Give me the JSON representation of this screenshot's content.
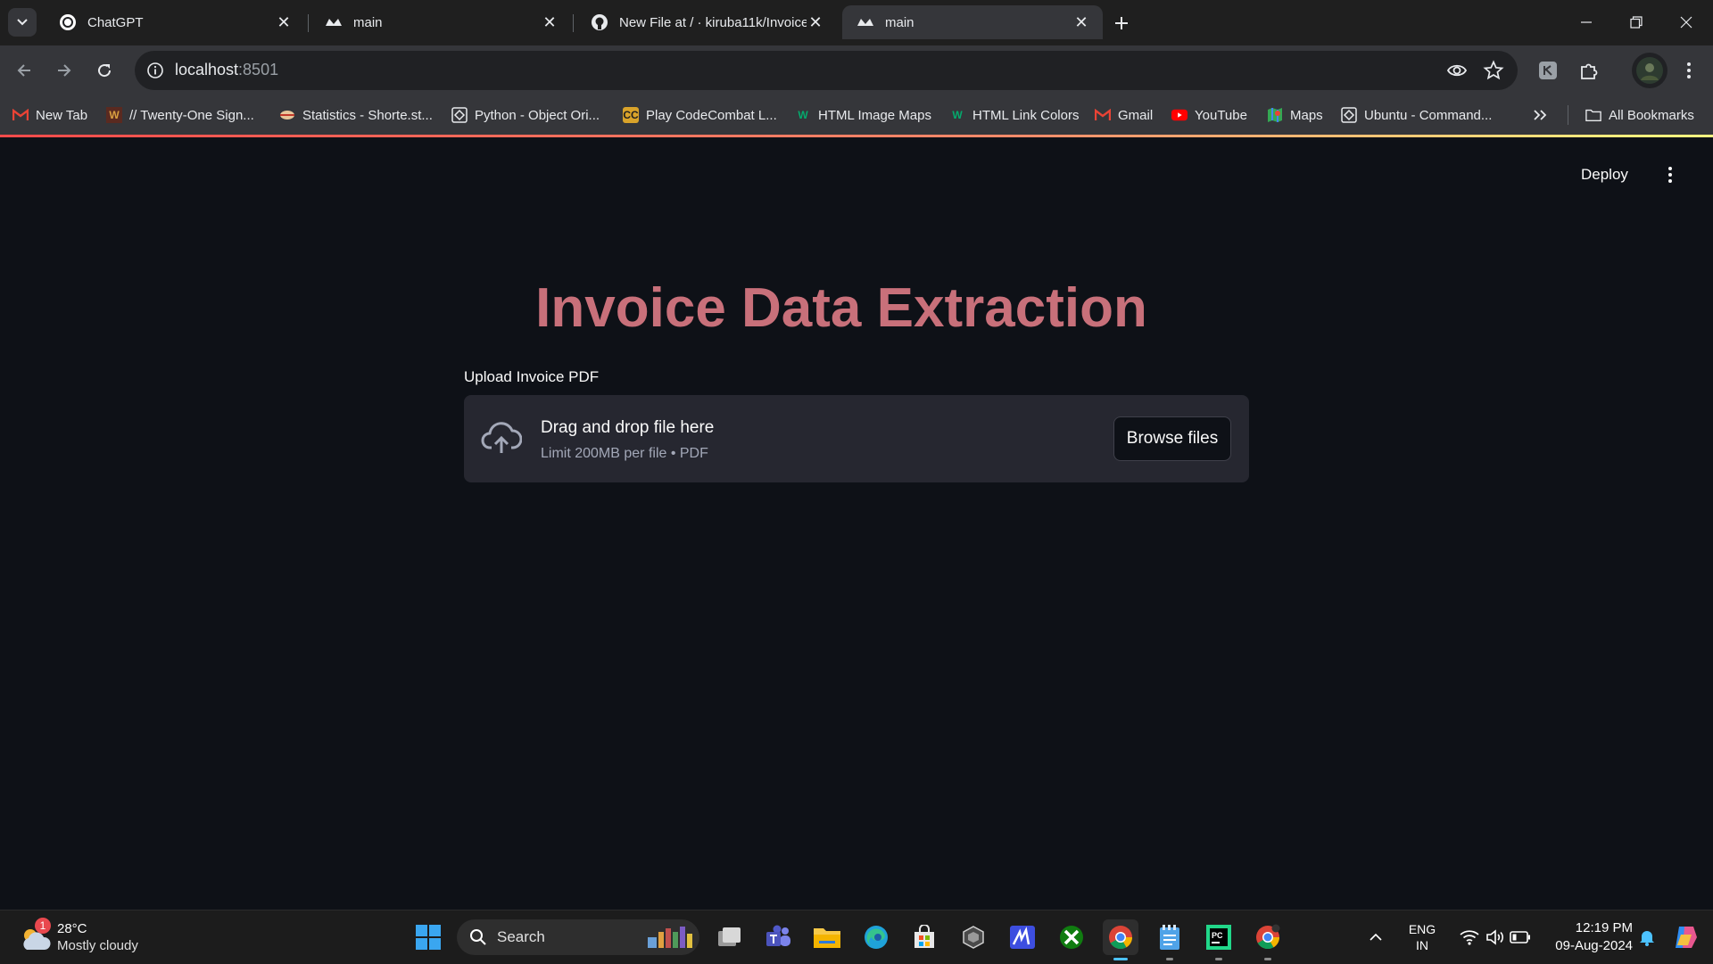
{
  "browser": {
    "tabs": [
      {
        "title": "ChatGPT",
        "icon": "chatgpt-icon"
      },
      {
        "title": "main",
        "icon": "streamlit-icon"
      },
      {
        "title": "New File at / · kiruba11k/Invoice",
        "icon": "github-icon"
      },
      {
        "title": "main",
        "icon": "streamlit-icon"
      }
    ],
    "url_host": "localhost",
    "url_port": ":8501",
    "bookmarks": [
      {
        "label": "New Tab",
        "icon": "gmail-icon"
      },
      {
        "label": "// Twenty-One Sign...",
        "icon": "site-icon"
      },
      {
        "label": "Statistics - Shorte.st...",
        "icon": "site-icon"
      },
      {
        "label": "Python - Object Ori...",
        "icon": "site-icon"
      },
      {
        "label": "Play CodeCombat L...",
        "icon": "codecombat-icon"
      },
      {
        "label": "HTML Image Maps",
        "icon": "w3schools-icon"
      },
      {
        "label": "HTML Link Colors",
        "icon": "w3schools-icon"
      },
      {
        "label": "Gmail",
        "icon": "gmail-icon"
      },
      {
        "label": "YouTube",
        "icon": "youtube-icon"
      },
      {
        "label": "Maps",
        "icon": "maps-icon"
      },
      {
        "label": "Ubuntu - Command...",
        "icon": "site-icon"
      }
    ],
    "all_bookmarks": "All Bookmarks"
  },
  "app": {
    "deploy_label": "Deploy",
    "title": "Invoice Data Extraction",
    "uploader": {
      "label": "Upload Invoice PDF",
      "drop_text": "Drag and drop file here",
      "limit_text": "Limit 200MB per file • PDF",
      "browse_label": "Browse files"
    }
  },
  "taskbar": {
    "weather": {
      "temp": "28°C",
      "condition": "Mostly cloudy",
      "badge": "1"
    },
    "search_label": "Search",
    "lang": "ENG",
    "region": "IN",
    "time": "12:19 PM",
    "date": "09-Aug-2024"
  },
  "colors": {
    "title": "#c8707a",
    "background": "#0e1117",
    "dropzone": "#262730"
  }
}
